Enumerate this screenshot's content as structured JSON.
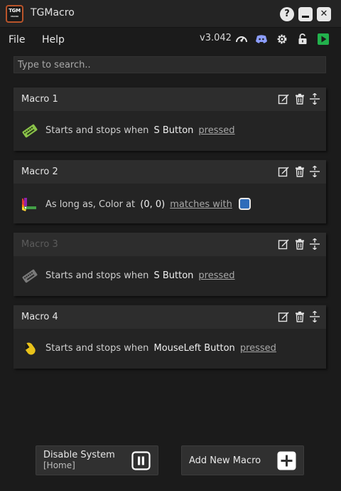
{
  "window": {
    "title": "TGMacro",
    "logo_text": "TGM",
    "logo_subtext": "MACRO",
    "help_label": "?",
    "close_label": "✕"
  },
  "menu": {
    "file": "File",
    "help": "Help",
    "version": "v3.042",
    "toolbar_icons": [
      "dashboard-icon",
      "discord-icon",
      "settings-gear-icon",
      "unlock-icon",
      "play-icon"
    ]
  },
  "search": {
    "placeholder": "Type to search..",
    "value": ""
  },
  "macros": [
    {
      "title": "Macro 1",
      "enabled": true,
      "trigger_icon": "keyboard-icon",
      "prefix": "Starts and stops when",
      "key": "S Button",
      "action": "pressed"
    },
    {
      "title": "Macro 2",
      "enabled": true,
      "trigger_icon": "color-palette-icon",
      "prefix": "As long as, Color at",
      "key": "(0, 0)",
      "action": "matches with",
      "swatch_color": "#2e6cba"
    },
    {
      "title": "Macro 3",
      "enabled": false,
      "trigger_icon": "keyboard-icon",
      "prefix": "Starts and stops when",
      "key": "S Button",
      "action": "pressed"
    },
    {
      "title": "Macro 4",
      "enabled": true,
      "trigger_icon": "mouse-left-icon",
      "prefix": "Starts and stops when",
      "key": "MouseLeft Button",
      "action": "pressed"
    }
  ],
  "footer": {
    "disable_label": "Disable System",
    "disable_hotkey": "[Home]",
    "add_label": "Add New Macro"
  },
  "colors": {
    "background": "#1b1b1b",
    "card": "#242424",
    "card_header": "#2d2d2d",
    "keyboard_icon": "#8bc34a",
    "mouse_icon": "#e8c21a",
    "play_icon": "#22b14c",
    "swatch": "#2e6cba"
  }
}
